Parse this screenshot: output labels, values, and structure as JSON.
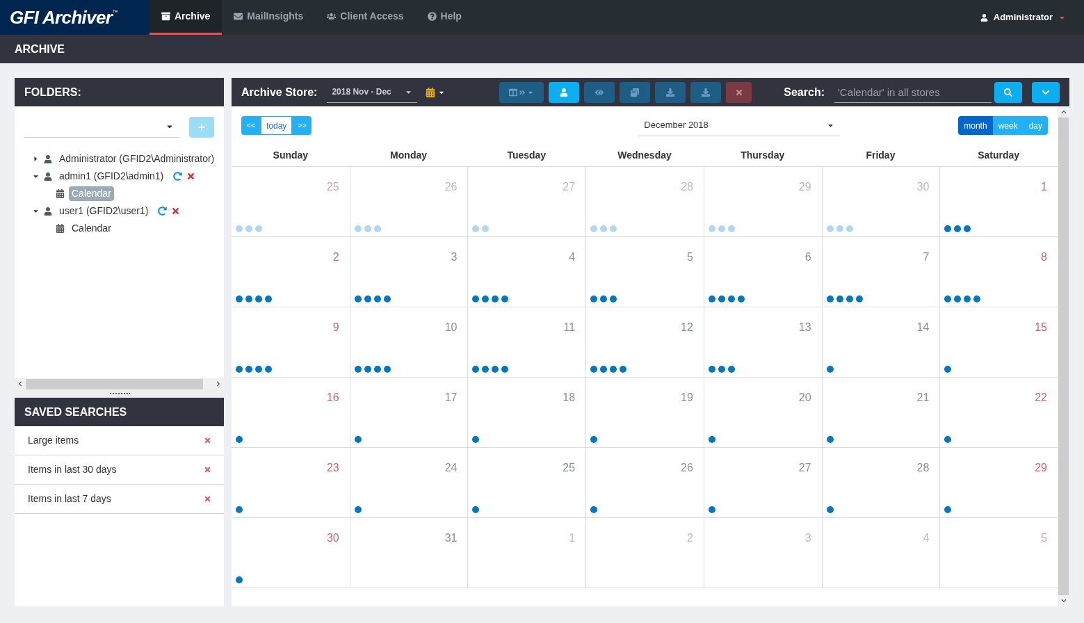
{
  "app": {
    "logo": "GFI Archiver",
    "logo_mark": "™"
  },
  "nav": [
    {
      "label": "Archive",
      "selected": true
    },
    {
      "label": "MailInsights",
      "selected": false
    },
    {
      "label": "Client Access",
      "selected": false
    },
    {
      "label": "Help",
      "selected": false
    }
  ],
  "user": {
    "name": "Administrator"
  },
  "page_title": "ARCHIVE",
  "folders": {
    "title": "FOLDERS:",
    "tree": [
      {
        "label": "Administrator (GFID2\\Administrator)",
        "kind": "user",
        "expanded": false,
        "selected": false
      },
      {
        "label": "admin1 (GFID2\\admin1)",
        "kind": "user",
        "expanded": true,
        "selected": false,
        "children": [
          {
            "label": "Calendar",
            "kind": "calendar",
            "selected": true
          }
        ]
      },
      {
        "label": "user1 (GFID2\\user1)",
        "kind": "user",
        "expanded": true,
        "selected": false,
        "children": [
          {
            "label": "Calendar",
            "kind": "calendar",
            "selected": false
          }
        ]
      }
    ]
  },
  "saved_searches": {
    "title": "SAVED SEARCHES",
    "items": [
      {
        "label": "Large items"
      },
      {
        "label": "Items in last 30 days"
      },
      {
        "label": "Items in last 7 days"
      }
    ]
  },
  "toolbar": {
    "store_label": "Archive Store:",
    "store_value": "2018 Nov - Dec",
    "buttons": [
      {
        "kind": "columns",
        "active": false
      },
      {
        "kind": "user",
        "active": true
      },
      {
        "kind": "eye",
        "active": false
      },
      {
        "kind": "windows",
        "active": false
      },
      {
        "kind": "download",
        "active": false
      },
      {
        "kind": "download",
        "active": false
      },
      {
        "kind": "delete",
        "active": false
      }
    ],
    "search_label": "Search:",
    "search_placeholder": "'Calendar' in all stores"
  },
  "calendar": {
    "prev": "<<",
    "today_label": "today",
    "next": ">>",
    "month_value": "December 2018",
    "views": [
      {
        "label": "month",
        "selected": true
      },
      {
        "label": "week",
        "selected": false
      },
      {
        "label": "day",
        "selected": false
      }
    ],
    "weekdays": [
      "Sunday",
      "Monday",
      "Tuesday",
      "Wednesday",
      "Thursday",
      "Friday",
      "Saturday"
    ],
    "weeks": [
      [
        {
          "day": "25",
          "other_month": true,
          "events": [
            {
              "color": "#b3d7ee"
            },
            {
              "color": "#b3d7ee"
            },
            {
              "color": "#b3d7ee"
            }
          ]
        },
        {
          "day": "26",
          "other_month": true,
          "events": [
            {
              "color": "#b3d7ee"
            },
            {
              "color": "#b3d7ee"
            },
            {
              "color": "#b3d7ee"
            }
          ]
        },
        {
          "day": "27",
          "other_month": true,
          "events": [
            {
              "color": "#b3d7ee"
            },
            {
              "color": "#b3d7ee"
            }
          ]
        },
        {
          "day": "28",
          "other_month": true,
          "events": [
            {
              "color": "#b3d7ee"
            },
            {
              "color": "#b3d7ee"
            },
            {
              "color": "#b3d7ee"
            }
          ]
        },
        {
          "day": "29",
          "other_month": true,
          "events": [
            {
              "color": "#b3d7ee"
            },
            {
              "color": "#b3d7ee"
            },
            {
              "color": "#b3d7ee"
            }
          ]
        },
        {
          "day": "30",
          "other_month": true,
          "events": [
            {
              "color": "#b3d7ee"
            },
            {
              "color": "#b3d7ee"
            },
            {
              "color": "#b3d7ee"
            }
          ]
        },
        {
          "day": "1",
          "other_month": false,
          "events": [
            {
              "color": "#0077c0"
            },
            {
              "color": "#0077c0"
            },
            {
              "color": "#0077c0"
            }
          ]
        }
      ],
      [
        {
          "day": "2",
          "other_month": false,
          "events": [
            {
              "color": "#0077c0"
            },
            {
              "color": "#0077c0"
            },
            {
              "color": "#0077c0"
            },
            {
              "color": "#0077c0"
            }
          ]
        },
        {
          "day": "3",
          "other_month": false,
          "events": [
            {
              "color": "#0077c0"
            },
            {
              "color": "#0077c0"
            },
            {
              "color": "#0077c0"
            },
            {
              "color": "#0077c0"
            }
          ]
        },
        {
          "day": "4",
          "other_month": false,
          "events": [
            {
              "color": "#0077c0"
            },
            {
              "color": "#0077c0"
            },
            {
              "color": "#0077c0"
            },
            {
              "color": "#0077c0"
            }
          ]
        },
        {
          "day": "5",
          "other_month": false,
          "events": [
            {
              "color": "#0077c0"
            },
            {
              "color": "#0077c0"
            },
            {
              "color": "#0077c0"
            }
          ]
        },
        {
          "day": "6",
          "other_month": false,
          "events": [
            {
              "color": "#0077c0"
            },
            {
              "color": "#0077c0"
            },
            {
              "color": "#0077c0"
            },
            {
              "color": "#0077c0"
            }
          ]
        },
        {
          "day": "7",
          "other_month": false,
          "events": [
            {
              "color": "#0077c0"
            },
            {
              "color": "#0077c0"
            },
            {
              "color": "#0077c0"
            },
            {
              "color": "#0077c0"
            }
          ]
        },
        {
          "day": "8",
          "other_month": false,
          "events": [
            {
              "color": "#0077c0"
            },
            {
              "color": "#0077c0"
            },
            {
              "color": "#0077c0"
            },
            {
              "color": "#0077c0"
            }
          ]
        }
      ],
      [
        {
          "day": "9",
          "other_month": false,
          "events": [
            {
              "color": "#0077c0"
            },
            {
              "color": "#0077c0"
            },
            {
              "color": "#0077c0"
            },
            {
              "color": "#0077c0"
            }
          ]
        },
        {
          "day": "10",
          "other_month": false,
          "events": [
            {
              "color": "#0077c0"
            },
            {
              "color": "#0077c0"
            },
            {
              "color": "#0077c0"
            },
            {
              "color": "#0077c0"
            }
          ]
        },
        {
          "day": "11",
          "other_month": false,
          "events": [
            {
              "color": "#0077c0"
            },
            {
              "color": "#0077c0"
            },
            {
              "color": "#0077c0"
            },
            {
              "color": "#0077c0"
            }
          ]
        },
        {
          "day": "12",
          "other_month": false,
          "events": [
            {
              "color": "#0077c0"
            },
            {
              "color": "#0077c0"
            },
            {
              "color": "#0077c0"
            },
            {
              "color": "#0077c0"
            }
          ]
        },
        {
          "day": "13",
          "other_month": false,
          "events": [
            {
              "color": "#0077c0"
            },
            {
              "color": "#0077c0"
            },
            {
              "color": "#0077c0"
            }
          ]
        },
        {
          "day": "14",
          "other_month": false,
          "events": [
            {
              "color": "#0077c0"
            }
          ]
        },
        {
          "day": "15",
          "other_month": false,
          "events": [
            {
              "color": "#0077c0"
            }
          ]
        }
      ],
      [
        {
          "day": "16",
          "other_month": false,
          "events": [
            {
              "color": "#0077c0"
            }
          ]
        },
        {
          "day": "17",
          "other_month": false,
          "events": [
            {
              "color": "#0077c0"
            }
          ]
        },
        {
          "day": "18",
          "other_month": false,
          "events": [
            {
              "color": "#0077c0"
            }
          ]
        },
        {
          "day": "19",
          "other_month": false,
          "events": [
            {
              "color": "#0077c0"
            }
          ]
        },
        {
          "day": "20",
          "other_month": false,
          "events": [
            {
              "color": "#0077c0"
            }
          ]
        },
        {
          "day": "21",
          "other_month": false,
          "events": [
            {
              "color": "#0077c0"
            }
          ]
        },
        {
          "day": "22",
          "other_month": false,
          "events": [
            {
              "color": "#0077c0"
            }
          ]
        }
      ],
      [
        {
          "day": "23",
          "other_month": false,
          "events": [
            {
              "color": "#0077c0"
            }
          ]
        },
        {
          "day": "24",
          "other_month": false,
          "events": [
            {
              "color": "#0077c0"
            }
          ]
        },
        {
          "day": "25",
          "other_month": false,
          "events": [
            {
              "color": "#0077c0"
            }
          ]
        },
        {
          "day": "26",
          "other_month": false,
          "events": [
            {
              "color": "#0077c0"
            }
          ]
        },
        {
          "day": "27",
          "other_month": false,
          "events": [
            {
              "color": "#0077c0"
            }
          ]
        },
        {
          "day": "28",
          "other_month": false,
          "events": [
            {
              "color": "#0077c0"
            }
          ]
        },
        {
          "day": "29",
          "other_month": false,
          "events": [
            {
              "color": "#0077c0"
            }
          ]
        }
      ],
      [
        {
          "day": "30",
          "other_month": false,
          "events": [
            {
              "color": "#0077c0"
            }
          ]
        },
        {
          "day": "31",
          "other_month": false
        },
        {
          "day": "1",
          "other_month": true
        },
        {
          "day": "2",
          "other_month": true
        },
        {
          "day": "3",
          "other_month": true
        },
        {
          "day": "4",
          "other_month": true
        },
        {
          "day": "5",
          "other_month": true
        }
      ]
    ]
  }
}
